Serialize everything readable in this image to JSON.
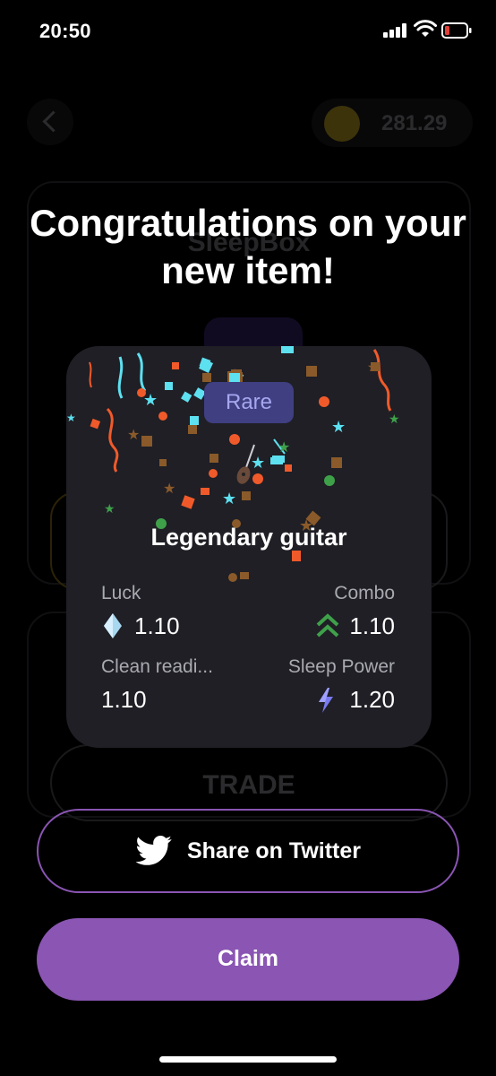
{
  "status_bar": {
    "time": "20:50",
    "battery_color": "#e0403a"
  },
  "background_screen": {
    "balance": "281.29",
    "title": "SleepBox",
    "trade_label": "TRADE"
  },
  "overlay": {
    "title": "Congratulations on your new item!"
  },
  "item": {
    "rarity": "Rare",
    "name": "Legendary guitar",
    "stats": {
      "luck": {
        "label": "Luck",
        "value": "1.10",
        "icon": "diamond-icon"
      },
      "combo": {
        "label": "Combo",
        "value": "1.10",
        "icon": "double-chevron-up-icon"
      },
      "clean_reading": {
        "label": "Clean readi...",
        "value": "1.10"
      },
      "sleep_power": {
        "label": "Sleep Power",
        "value": "1.20",
        "icon": "lightning-icon"
      }
    }
  },
  "buttons": {
    "share_label": "Share on Twitter",
    "claim_label": "Claim"
  },
  "colors": {
    "accent": "#8a55b3",
    "card": "#1f1f25",
    "rare_badge_bg": "#3f3f82",
    "rare_badge_text": "#a7a7f0"
  }
}
